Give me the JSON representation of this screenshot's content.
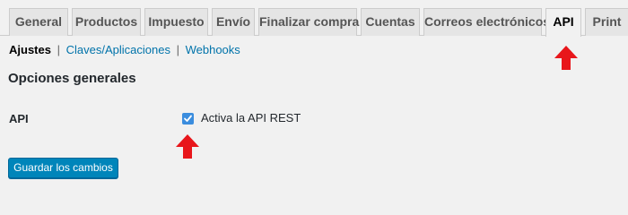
{
  "tabs": [
    {
      "label": "General",
      "active": false
    },
    {
      "label": "Productos",
      "active": false
    },
    {
      "label": "Impuesto",
      "active": false
    },
    {
      "label": "Envío",
      "active": false
    },
    {
      "label": "Finalizar compra",
      "active": false
    },
    {
      "label": "Cuentas",
      "active": false
    },
    {
      "label": "Correos electrónicos",
      "active": false
    },
    {
      "label": "API",
      "active": true
    },
    {
      "label": "Print",
      "active": false
    }
  ],
  "subnav": {
    "current": "Ajustes",
    "separator": "|",
    "links": [
      "Claves/Aplicaciones",
      "Webhooks"
    ]
  },
  "section": {
    "title": "Opciones generales"
  },
  "setting": {
    "label": "API",
    "checkbox_label": "Activa la API REST",
    "checked": true
  },
  "save_button": "Guardar los cambios",
  "colors": {
    "annotation_arrow": "#e8161b",
    "link": "#0073aa",
    "button": "#0085ba",
    "checkbox": "#3b8dde"
  },
  "annotations": [
    "arrow-up-icon",
    "arrow-up-icon"
  ]
}
